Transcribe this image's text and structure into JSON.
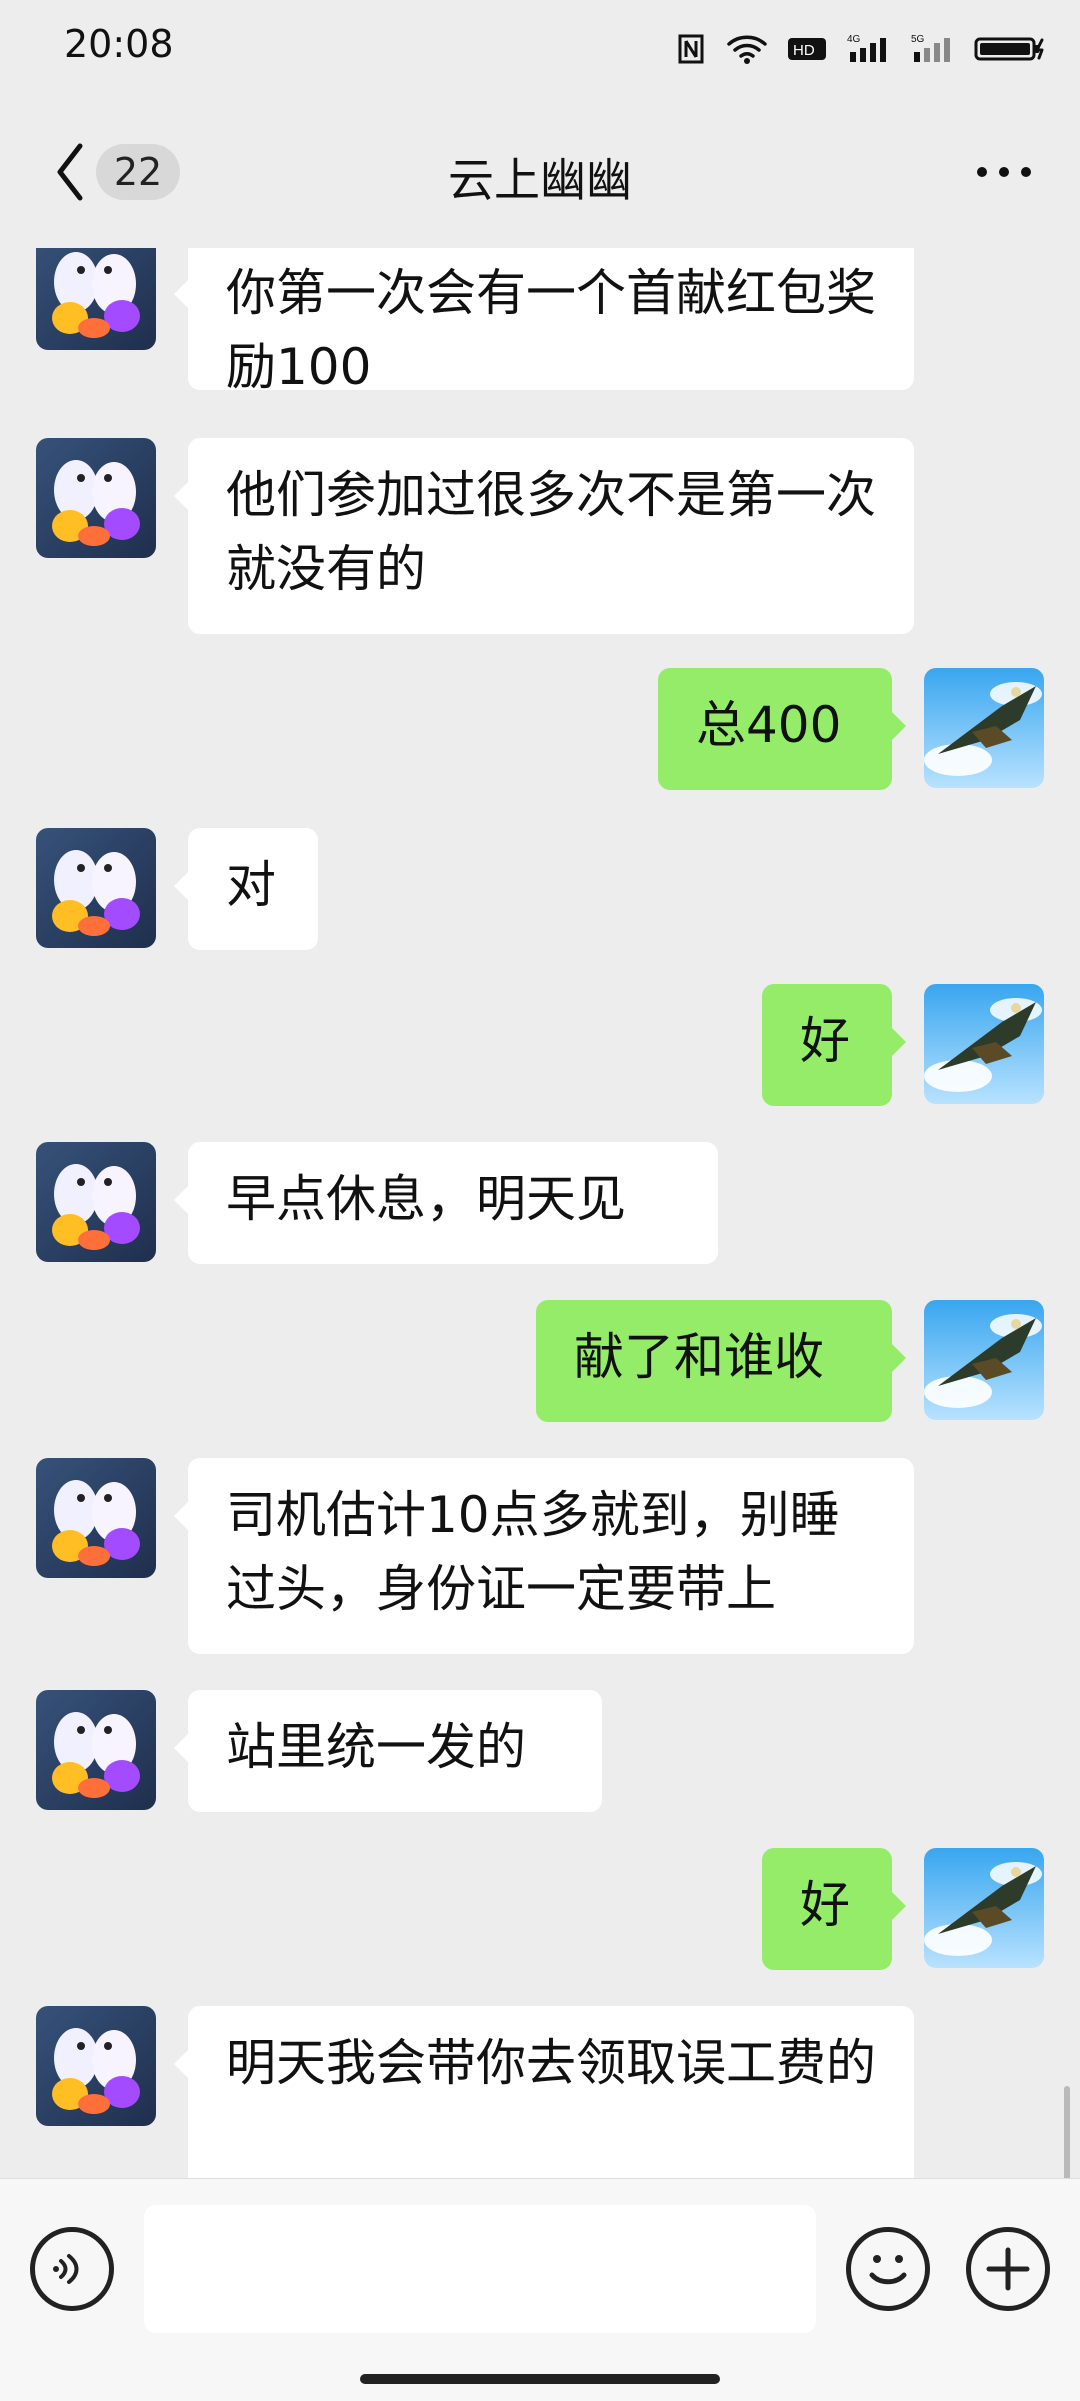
{
  "status_bar": {
    "time": "20:08",
    "network_badges": [
      "HD",
      "4G",
      "5G"
    ]
  },
  "header": {
    "back_badge_count": "22",
    "title": "云上幽幽"
  },
  "messages": [
    {
      "side": "left",
      "text": "你第一次会有一个首献红包奖励100",
      "avatar_icon": "birds-avatar-icon"
    },
    {
      "side": "left",
      "text": "他们参加过很多次不是第一次就没有的",
      "avatar_icon": "birds-avatar-icon"
    },
    {
      "side": "right",
      "text": "总400",
      "avatar_icon": "eagle-avatar-icon"
    },
    {
      "side": "left",
      "text": "对",
      "avatar_icon": "birds-avatar-icon"
    },
    {
      "side": "right",
      "text": "好",
      "avatar_icon": "eagle-avatar-icon"
    },
    {
      "side": "left",
      "text": "早点休息，明天见",
      "avatar_icon": "birds-avatar-icon"
    },
    {
      "side": "right",
      "text": "献了和谁收",
      "avatar_icon": "eagle-avatar-icon"
    },
    {
      "side": "left",
      "text": "司机估计10点多就到，别睡过头，身份证一定要带上",
      "avatar_icon": "birds-avatar-icon"
    },
    {
      "side": "left",
      "text": "站里统一发的",
      "avatar_icon": "birds-avatar-icon"
    },
    {
      "side": "right",
      "text": "好",
      "avatar_icon": "eagle-avatar-icon"
    },
    {
      "side": "left",
      "text": "明天我会带你去领取误工费的",
      "avatar_icon": "birds-avatar-icon"
    }
  ],
  "composer": {
    "input_value": "",
    "icons": [
      "voice-icon",
      "emoji-icon",
      "plus-icon"
    ]
  },
  "colors": {
    "background": "#ededed",
    "incoming_bubble": "#ffffff",
    "outgoing_bubble": "#95ec69",
    "text": "#111111"
  }
}
